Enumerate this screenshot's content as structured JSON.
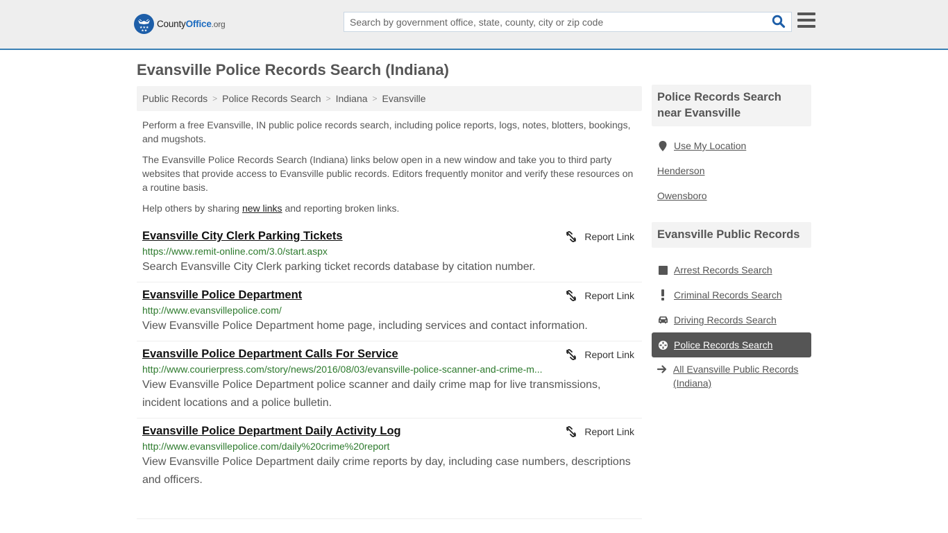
{
  "header": {
    "logo": {
      "part1": "County",
      "part2": "Office",
      "part3": ".org"
    },
    "search_placeholder": "Search by government office, state, county, city or zip code",
    "search_value": "",
    "brand_color": "#1d5ea8",
    "accent_line_color": "#3a80b4"
  },
  "page": {
    "title": "Evansville Police Records Search (Indiana)"
  },
  "breadcrumb": [
    {
      "label": "Public Records"
    },
    {
      "label": "Police Records Search"
    },
    {
      "label": "Indiana"
    },
    {
      "label": "Evansville"
    }
  ],
  "breadcrumb_separator": ">",
  "intro": {
    "p1": "Perform a free Evansville, IN public police records search, including police reports, logs, notes, blotters, bookings, and mugshots.",
    "p2": "The Evansville Police Records Search (Indiana) links below open in a new window and take you to third party websites that provide access to Evansville public records. Editors frequently monitor and verify these resources on a routine basis.",
    "p3_before": "Help others by sharing ",
    "p3_link": "new links",
    "p3_after": " and reporting broken links."
  },
  "report_label": "Report Link",
  "results": [
    {
      "title": "Evansville City Clerk Parking Tickets",
      "url": "https://www.remit-online.com/3.0/start.aspx",
      "description": "Search Evansville City Clerk parking ticket records database by citation number."
    },
    {
      "title": "Evansville Police Department",
      "url": "http://www.evansvillepolice.com/",
      "description": "View Evansville Police Department home page, including services and contact information."
    },
    {
      "title": "Evansville Police Department Calls For Service",
      "url": "http://www.courierpress.com/story/news/2016/08/03/evansville-police-scanner-and-crime-m...",
      "description": "View Evansville Police Department police scanner and daily crime map for live transmissions, incident locations and a police bulletin."
    },
    {
      "title": "Evansville Police Department Daily Activity Log",
      "url": "http://www.evansvillepolice.com/daily%20crime%20report",
      "description": "View Evansville Police Department daily crime reports by day, including case numbers, descriptions and officers."
    }
  ],
  "sidebar": {
    "nearby": {
      "heading": "Police Records Search near Evansville",
      "items": [
        {
          "label": "Use My Location",
          "icon": "map-marker-icon"
        },
        {
          "label": "Henderson"
        },
        {
          "label": "Owensboro"
        }
      ]
    },
    "public_records": {
      "heading": "Evansville Public Records",
      "items": [
        {
          "label": "Arrest Records Search",
          "icon": "square-icon",
          "active": false
        },
        {
          "label": "Criminal Records Search",
          "icon": "exclamation-icon",
          "active": false
        },
        {
          "label": "Driving Records Search",
          "icon": "car-icon",
          "active": false
        },
        {
          "label": "Police Records Search",
          "icon": "crosshair-icon",
          "active": true
        },
        {
          "label": "All Evansville Public Records (Indiana)",
          "icon": "arrow-right-icon",
          "active": false
        }
      ]
    }
  }
}
